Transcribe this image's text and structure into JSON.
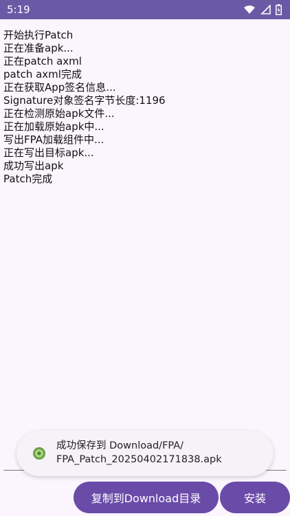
{
  "status_bar": {
    "time": "5:19",
    "icons": [
      "wifi-icon",
      "signal-icon",
      "battery-icon"
    ]
  },
  "log_lines": [
    "开始执行Patch",
    "正在准备apk...",
    "正在patch axml",
    "patch axml完成",
    "正在获取App签名信息...",
    "Signature对象签名字节长度:1196",
    "正在检测原始apk文件...",
    "正在加载原始apk中...",
    "写出FPA加载组件中...",
    "正在写出目标apk...",
    "成功写出apk",
    "Patch完成"
  ],
  "toast": {
    "line1": "成功保存到 Download/FPA/",
    "line2": "FPA_Patch_20250402171838.apk",
    "icon": "app-icon"
  },
  "buttons": {
    "copy_label": "复制到Download目录",
    "install_label": "安装"
  },
  "colors": {
    "status_bar": "#6a5aa6",
    "background": "#fbf5fd",
    "button": "#6a4ba8",
    "toast": "#f6f2f7"
  }
}
